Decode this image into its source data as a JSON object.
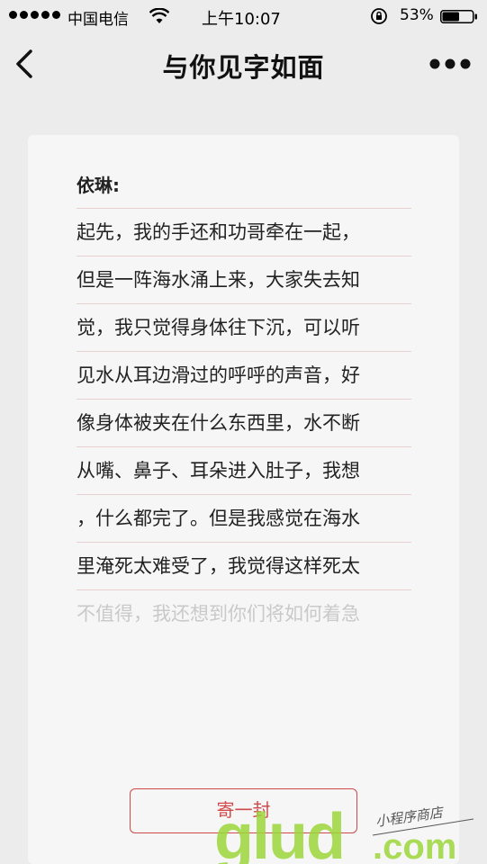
{
  "status_bar": {
    "carrier": "中国电信",
    "time": "上午10:07",
    "battery": "53%"
  },
  "nav": {
    "title": "与你见字如面"
  },
  "letter": {
    "salutation": "依琳:",
    "lines": [
      "起先，我的手还和功哥牵在一起，",
      "但是一阵海水涌上来，大家失去知",
      "觉，我只觉得身体往下沉，可以听",
      "见水从耳边滑过的呼呼的声音，好",
      "像身体被夹在什么东西里，水不断",
      "从嘴、鼻子、耳朵进入肚子，我想",
      "，什么都完了。但是我感觉在海水",
      "里淹死太难受了，我觉得这样死太",
      "不值得，我还想到你们将如何着急"
    ]
  },
  "actions": {
    "send_label": "寄一封"
  },
  "watermark": {
    "logo_text": "glud",
    "domain": ".com",
    "tagline": "小程序商店"
  },
  "colors": {
    "accent": "#cf4a4a",
    "background": "#ececec",
    "card": "#f6f6f6",
    "watermark_green": "#9bd63a"
  },
  "icons": [
    "signal-icon",
    "wifi-icon",
    "lock-rotation-icon",
    "battery-icon",
    "back-icon",
    "more-icon"
  ]
}
